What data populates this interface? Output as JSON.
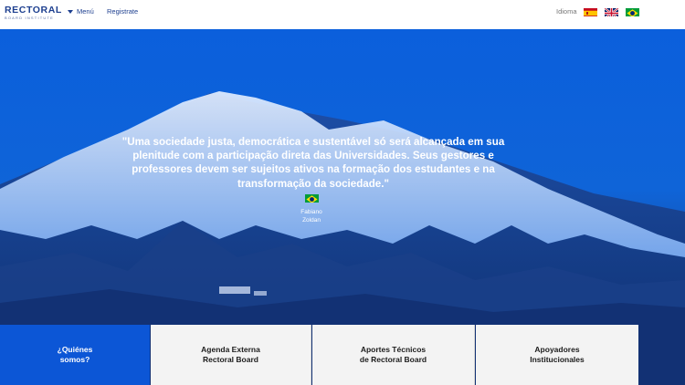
{
  "header": {
    "logo_main": "RECTORAL",
    "logo_sub": "BOARD INSTITUTE",
    "menu_label": "Menú",
    "register_label": "Registrate",
    "language_label": "Idioma",
    "languages": [
      "es-flag-icon",
      "uk-flag-icon",
      "br-flag-icon"
    ]
  },
  "hero": {
    "quote": "\"Uma sociedade justa, democrática e sustentável só será alcançada em sua plenitude com a participação direta das Universidades. Seus gestores e professores devem ser sujeitos ativos na formação dos estudantes e na transformação da sociedade.\"",
    "author_flag": "br-flag-icon",
    "author_first": "Fabiano",
    "author_last": "Zoldan"
  },
  "cards": [
    {
      "label": "¿Quiénes\nsomos?"
    },
    {
      "label": "Agenda Externa\nRectoral Board"
    },
    {
      "label": "Aportes Técnicos\nde Rectoral Board"
    },
    {
      "label": "Apoyadores\nInstitucionales"
    }
  ],
  "colors": {
    "brand": "#1d3f8f",
    "hero_blue": "#0b5fdc",
    "active_card": "#0c56d6"
  }
}
